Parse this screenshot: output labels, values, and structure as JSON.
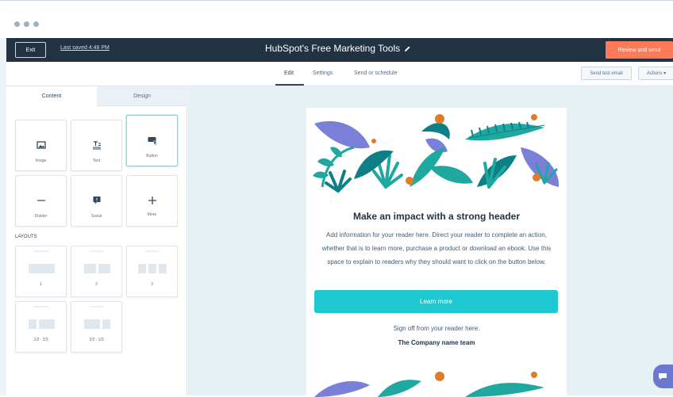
{
  "window": {
    "dot_count": 3
  },
  "topbar": {
    "exit_label": "Exit",
    "last_saved": "Last saved 4:48 PM",
    "title": "HubSpot's Free Marketing Tools",
    "review_label": "Review and send"
  },
  "subbar": {
    "tabs": [
      {
        "label": "Edit"
      },
      {
        "label": "Settings"
      },
      {
        "label": "Send or schedule"
      }
    ],
    "send_test_label": "Send test email",
    "actions_label": "Actions ▾"
  },
  "sidebar": {
    "tabs": [
      {
        "label": "Content"
      },
      {
        "label": "Design"
      }
    ],
    "modules": [
      {
        "label": "Image",
        "icon": "image-icon"
      },
      {
        "label": "Text",
        "icon": "text-icon"
      },
      {
        "label": "Button",
        "icon": "button-icon"
      },
      {
        "label": "Divider",
        "icon": "divider-icon"
      },
      {
        "label": "Social",
        "icon": "social-icon"
      },
      {
        "label": "More",
        "icon": "plus-icon"
      }
    ],
    "layouts_label": "LAYOUTS",
    "layouts": [
      {
        "label": "1"
      },
      {
        "label": "2"
      },
      {
        "label": "3"
      },
      {
        "label": "1/3 : 2/3"
      },
      {
        "label": "2/3 : 1/3"
      }
    ]
  },
  "email": {
    "headline": "Make an impact with a strong header",
    "body": "Add information for your reader here. Direct your reader to complete an action, whether that is to learn more, purchase a product or download an ebook. Use this space to explain to readers why they should want to click on the button below.",
    "button_label": "Learn more",
    "signoff": "Sign off from your reader here.",
    "company": "The Company name team"
  },
  "colors": {
    "topbar": "#213343",
    "accent_orange": "#ff7a59",
    "accent_teal": "#1ec8d0",
    "canvas": "#e6f1f6",
    "leaf_teal": "#1fa8a0",
    "leaf_purple": "#7a7fd8",
    "berry_orange": "#e07b2a"
  }
}
